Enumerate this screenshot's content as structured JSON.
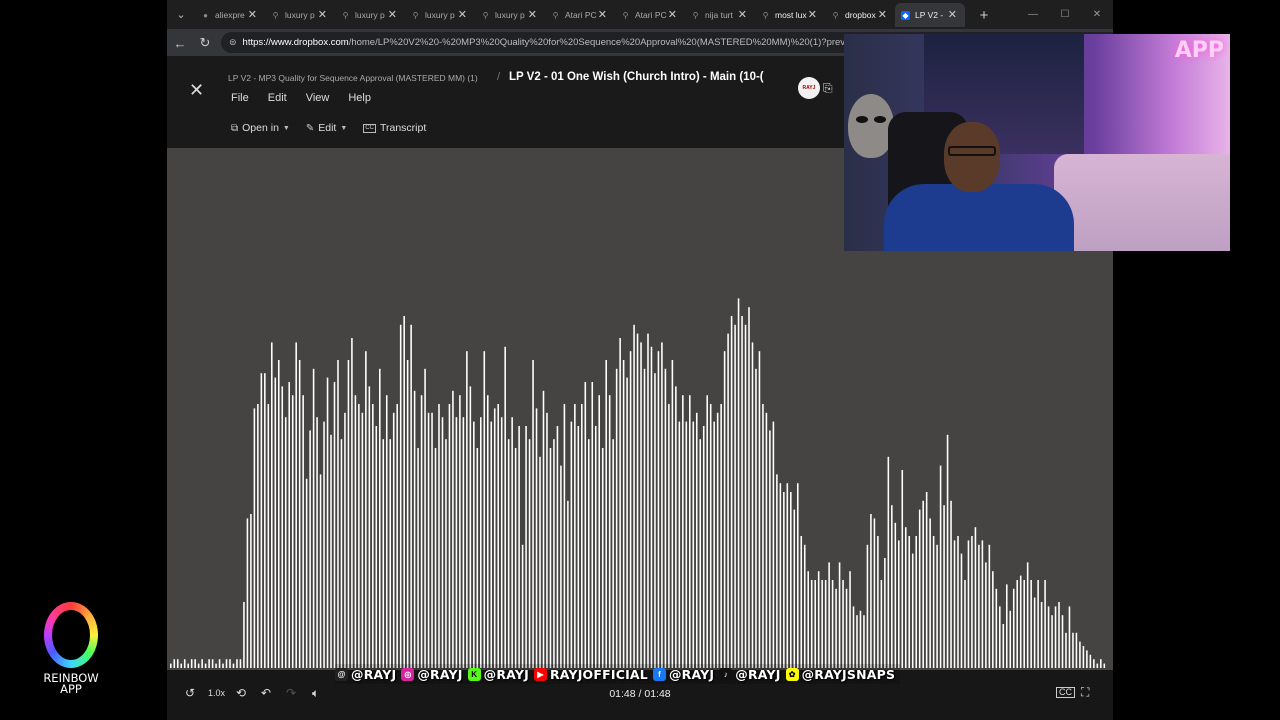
{
  "browser": {
    "tabs": [
      {
        "title": "aliexpre",
        "icon": "aliexpress-icon",
        "active": false,
        "bold": false
      },
      {
        "title": "luxury p",
        "icon": "search-icon",
        "active": false,
        "bold": false
      },
      {
        "title": "luxury p",
        "icon": "search-icon",
        "active": false,
        "bold": false
      },
      {
        "title": "luxury p",
        "icon": "search-icon",
        "active": false,
        "bold": false
      },
      {
        "title": "luxury p",
        "icon": "search-icon",
        "active": false,
        "bold": false
      },
      {
        "title": "Atari PC",
        "icon": "search-icon",
        "active": false,
        "bold": false
      },
      {
        "title": "Atari PC",
        "icon": "search-icon",
        "active": false,
        "bold": false
      },
      {
        "title": "nija turt",
        "icon": "search-icon",
        "active": false,
        "bold": false
      },
      {
        "title": "most lux",
        "icon": "search-icon",
        "active": false,
        "bold": true
      },
      {
        "title": "dropbox",
        "icon": "search-icon",
        "active": false,
        "bold": true
      },
      {
        "title": "LP V2 -",
        "icon": "dropbox-icon",
        "active": true,
        "bold": true
      }
    ],
    "new_tab": "+",
    "url_host": "https://www.dropbox.com",
    "url_path": "/home/LP%20V2%20-%20MP3%20Quality%20for%20Sequence%20Approval%20(MASTERED%20MM)%20(1)?preview=..."
  },
  "dropbox": {
    "breadcrumb": "LP V2 - MP3 Quality for Sequence Approval (MASTERED MM) (1)",
    "separator": "/",
    "file_title": "LP V2 - 01 One Wish (Church Intro) - Main (10-(",
    "avatar_text": "RAYJ",
    "menu": [
      "File",
      "Edit",
      "View",
      "Help"
    ],
    "toolbar": {
      "open_in": "Open in",
      "edit": "Edit",
      "transcript": "Transcript"
    }
  },
  "player": {
    "speed": "1.0x",
    "current_time": "01:48",
    "total_time": "01:48",
    "progress": 1.0
  },
  "socials": [
    {
      "platform": "threads",
      "icon": "threads-icon",
      "color": "#222222",
      "glyph": "@",
      "handle": "@RAYJ"
    },
    {
      "platform": "instagram",
      "icon": "instagram-icon",
      "color": "#d6249f",
      "glyph": "◎",
      "handle": "@RAYJ"
    },
    {
      "platform": "kick",
      "icon": "kick-icon",
      "color": "#53fc18",
      "glyph": "K",
      "handle": "@RAYJ"
    },
    {
      "platform": "youtube",
      "icon": "youtube-icon",
      "color": "#ff0000",
      "glyph": "▶",
      "handle": "RAYJOFFICIAL"
    },
    {
      "platform": "facebook",
      "icon": "facebook-icon",
      "color": "#1877f2",
      "glyph": "f",
      "handle": "@RAYJ"
    },
    {
      "platform": "tiktok",
      "icon": "tiktok-icon",
      "color": "#111111",
      "glyph": "♪",
      "handle": "@RAYJ"
    },
    {
      "platform": "snapchat",
      "icon": "snapchat-icon",
      "color": "#fffc00",
      "glyph": "✿",
      "handle": "@RAYJSNAPS"
    }
  ],
  "webcam": {
    "logo": "APP"
  },
  "branding": {
    "line1": "REINBOW",
    "line2": "APP"
  },
  "waveform": {
    "color": "#ffffff",
    "background": "#464442",
    "levels": [
      0.01,
      0.02,
      0.02,
      0.01,
      0.02,
      0.01,
      0.02,
      0.02,
      0.01,
      0.02,
      0.01,
      0.02,
      0.02,
      0.01,
      0.02,
      0.01,
      0.02,
      0.02,
      0.01,
      0.02,
      0.02,
      0.15,
      0.34,
      0.35,
      0.59,
      0.6,
      0.67,
      0.67,
      0.6,
      0.74,
      0.66,
      0.7,
      0.64,
      0.57,
      0.65,
      0.62,
      0.74,
      0.7,
      0.62,
      0.43,
      0.54,
      0.68,
      0.57,
      0.44,
      0.56,
      0.66,
      0.53,
      0.65,
      0.7,
      0.52,
      0.58,
      0.7,
      0.75,
      0.62,
      0.6,
      0.58,
      0.72,
      0.64,
      0.6,
      0.55,
      0.68,
      0.52,
      0.62,
      0.52,
      0.58,
      0.6,
      0.78,
      0.8,
      0.7,
      0.78,
      0.63,
      0.5,
      0.62,
      0.68,
      0.58,
      0.58,
      0.5,
      0.6,
      0.57,
      0.52,
      0.6,
      0.63,
      0.57,
      0.62,
      0.57,
      0.72,
      0.64,
      0.56,
      0.5,
      0.57,
      0.72,
      0.62,
      0.56,
      0.59,
      0.6,
      0.57,
      0.73,
      0.52,
      0.57,
      0.5,
      0.55,
      0.28,
      0.55,
      0.52,
      0.7,
      0.59,
      0.48,
      0.63,
      0.58,
      0.5,
      0.52,
      0.55,
      0.46,
      0.6,
      0.38,
      0.56,
      0.6,
      0.55,
      0.6,
      0.65,
      0.52,
      0.65,
      0.55,
      0.62,
      0.5,
      0.7,
      0.62,
      0.52,
      0.68,
      0.75,
      0.7,
      0.66,
      0.72,
      0.78,
      0.76,
      0.74,
      0.68,
      0.76,
      0.73,
      0.67,
      0.72,
      0.74,
      0.68,
      0.6,
      0.7,
      0.64,
      0.56,
      0.62,
      0.56,
      0.62,
      0.56,
      0.58,
      0.52,
      0.55,
      0.62,
      0.6,
      0.56,
      0.58,
      0.6,
      0.72,
      0.76,
      0.8,
      0.78,
      0.84,
      0.8,
      0.78,
      0.82,
      0.74,
      0.68,
      0.72,
      0.6,
      0.58,
      0.54,
      0.56,
      0.44,
      0.42,
      0.4,
      0.42,
      0.4,
      0.36,
      0.42,
      0.3,
      0.28,
      0.22,
      0.2,
      0.2,
      0.22,
      0.2,
      0.2,
      0.24,
      0.2,
      0.18,
      0.24,
      0.2,
      0.18,
      0.22,
      0.14,
      0.12,
      0.13,
      0.12,
      0.28,
      0.35,
      0.34,
      0.3,
      0.2,
      0.25,
      0.48,
      0.37,
      0.33,
      0.29,
      0.45,
      0.32,
      0.3,
      0.26,
      0.3,
      0.36,
      0.38,
      0.4,
      0.34,
      0.3,
      0.28,
      0.46,
      0.37,
      0.53,
      0.38,
      0.29,
      0.3,
      0.26,
      0.2,
      0.29,
      0.3,
      0.32,
      0.28,
      0.29,
      0.24,
      0.28,
      0.22,
      0.18,
      0.14,
      0.1,
      0.19,
      0.13,
      0.18,
      0.2,
      0.21,
      0.2,
      0.24,
      0.2,
      0.16,
      0.2,
      0.15,
      0.2,
      0.14,
      0.12,
      0.14,
      0.15,
      0.12,
      0.08,
      0.14,
      0.08,
      0.08,
      0.06,
      0.05,
      0.04,
      0.03,
      0.02,
      0.01,
      0.02,
      0.01
    ]
  }
}
